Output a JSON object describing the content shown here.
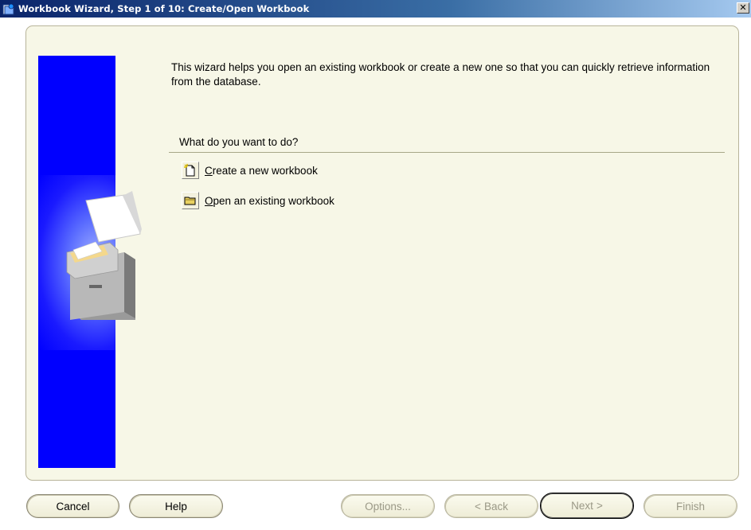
{
  "window": {
    "title": "Workbook Wizard, Step 1 of 10: Create/Open Workbook",
    "close_glyph": "✕"
  },
  "intro": {
    "text": "This wizard helps you open an existing workbook or create a new one so that you can quickly retrieve information from the database."
  },
  "question": {
    "label": "What do you want to do?"
  },
  "options": [
    {
      "mnemonic": "C",
      "rest": "reate a new workbook",
      "icon": "new-workbook-icon"
    },
    {
      "mnemonic": "O",
      "rest": "pen an existing workbook",
      "icon": "open-folder-icon"
    }
  ],
  "buttons": {
    "cancel": "Cancel",
    "help": "Help",
    "options": "Options...",
    "back": "Back",
    "next": "Next",
    "finish": "Finish",
    "back_prefix": "<",
    "next_suffix": ">"
  },
  "colors": {
    "banner": "#0000ff",
    "panel": "#f7f7e7",
    "title_bar": "#0a246a"
  }
}
